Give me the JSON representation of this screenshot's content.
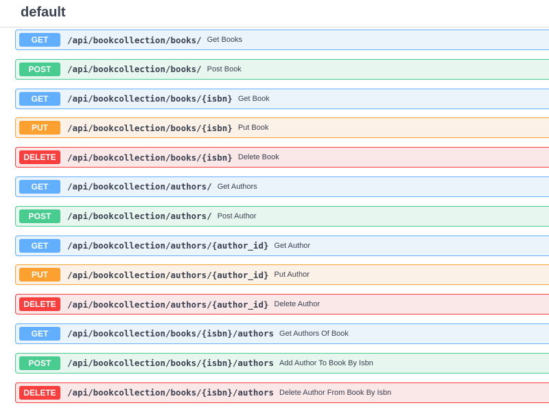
{
  "section": {
    "title": "default"
  },
  "operations": [
    {
      "method": "GET",
      "kind": "get",
      "path": "/api/bookcollection/books/",
      "summary": "Get Books"
    },
    {
      "method": "POST",
      "kind": "post",
      "path": "/api/bookcollection/books/",
      "summary": "Post Book"
    },
    {
      "method": "GET",
      "kind": "get",
      "path": "/api/bookcollection/books/{isbn}",
      "summary": "Get Book"
    },
    {
      "method": "PUT",
      "kind": "put",
      "path": "/api/bookcollection/books/{isbn}",
      "summary": "Put Book"
    },
    {
      "method": "DELETE",
      "kind": "delete",
      "path": "/api/bookcollection/books/{isbn}",
      "summary": "Delete Book"
    },
    {
      "method": "GET",
      "kind": "get",
      "path": "/api/bookcollection/authors/",
      "summary": "Get Authors"
    },
    {
      "method": "POST",
      "kind": "post",
      "path": "/api/bookcollection/authors/",
      "summary": "Post Author"
    },
    {
      "method": "GET",
      "kind": "get",
      "path": "/api/bookcollection/authors/{author_id}",
      "summary": "Get Author"
    },
    {
      "method": "PUT",
      "kind": "put",
      "path": "/api/bookcollection/authors/{author_id}",
      "summary": "Put Author"
    },
    {
      "method": "DELETE",
      "kind": "delete",
      "path": "/api/bookcollection/authors/{author_id}",
      "summary": "Delete Author"
    },
    {
      "method": "GET",
      "kind": "get",
      "path": "/api/bookcollection/books/{isbn}/authors",
      "summary": "Get Authors Of Book"
    },
    {
      "method": "POST",
      "kind": "post",
      "path": "/api/bookcollection/books/{isbn}/authors",
      "summary": "Add Author To Book By Isbn"
    },
    {
      "method": "DELETE",
      "kind": "delete",
      "path": "/api/bookcollection/books/{isbn}/authors",
      "summary": "Delete Author From Book By Isbn"
    }
  ],
  "colors": {
    "get": "#61affe",
    "post": "#49cc90",
    "put": "#fca130",
    "delete": "#f93e3e",
    "text": "#3b4151"
  }
}
